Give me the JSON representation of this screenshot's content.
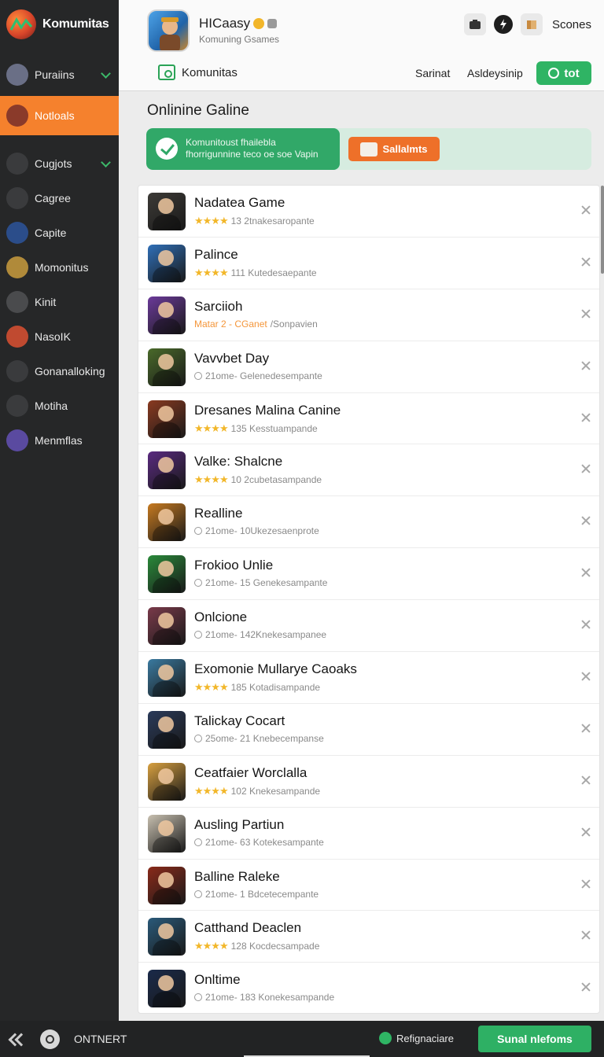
{
  "sidebar": {
    "brand": "Komumitas",
    "items": [
      {
        "label": "Puraiins",
        "icon": "controller-icon",
        "color": "#6a6f86",
        "chevron": true
      },
      {
        "label": "Notloals",
        "icon": "avatar-icon",
        "color": "#8a3a2a",
        "active": true
      },
      {
        "label": "Cugjots",
        "icon": "hammer-icon",
        "color": "#3a3b3d",
        "chevron": true
      },
      {
        "label": "Cagree",
        "icon": "chart-icon",
        "color": "#3a3b3d"
      },
      {
        "label": "Capite",
        "icon": "globe-icon",
        "color": "#2b4d8a"
      },
      {
        "label": "Momonitus",
        "icon": "sun-icon",
        "color": "#b08a3a"
      },
      {
        "label": "Kinit",
        "icon": "camera-icon",
        "color": "#4a4b4d"
      },
      {
        "label": "NasoIK",
        "icon": "face-icon",
        "color": "#c04a30"
      },
      {
        "label": "Gonanalloking",
        "icon": "planet-icon",
        "color": "#3a3b3d"
      },
      {
        "label": "Motiha",
        "icon": "pin-icon",
        "color": "#3a3b3d"
      },
      {
        "label": "Menmflas",
        "icon": "wand-icon",
        "color": "#5a4aa0"
      }
    ]
  },
  "header": {
    "app_title": "HICaasy",
    "app_subtitle": "Komuning Gsames",
    "scones": "Scones",
    "tab": "Komunitas",
    "link_1": "Sarinat",
    "link_2": "Asldeysinip",
    "cta": "tot"
  },
  "main": {
    "section_title": "Onlinine Galine",
    "banner_line1": "Komunitoust fhailebla",
    "banner_line2": "fhorrigunnine teco oe soe Vapin",
    "banner_button": "Sallalmts"
  },
  "games": [
    {
      "name": "Nadatea Game",
      "meta": "13 2tnakesaropante",
      "stars": true,
      "color": "#3c3a36"
    },
    {
      "name": "Palince",
      "meta": "111 Kutedesaepante",
      "stars": true,
      "color": "#2f6fb8"
    },
    {
      "name": "Sarciioh",
      "meta_orange": "Matar 2 - CGanet",
      "meta": "/Sonpavien",
      "color": "#6b3a9a"
    },
    {
      "name": "Vavvbet Day",
      "meta": "21ome- Gelenedesempante",
      "pin": true,
      "color": "#4a6a2a"
    },
    {
      "name": "Dresanes Malina Canine",
      "meta": "135 Kesstuampande",
      "stars": true,
      "color": "#8a3a20"
    },
    {
      "name": "Valke: Shalcne",
      "meta": "10 2cubetasampande",
      "stars": true,
      "color": "#5a2a80"
    },
    {
      "name": "Realline",
      "meta": "21ome- 10Ukezesaenprote",
      "pin": true,
      "color": "#c77a20"
    },
    {
      "name": "Frokioo Unlie",
      "meta": "21ome- 15 Genekesampante",
      "pin": true,
      "color": "#2a8a3a"
    },
    {
      "name": "Onlcione",
      "meta": "21ome- 142Knekesampanee",
      "pin": true,
      "color": "#7a3a4a"
    },
    {
      "name": "Exomonie Mullarye Caoaks",
      "meta": "185 Kotadisampande",
      "stars": true,
      "color": "#3a7aa0"
    },
    {
      "name": "Talickay Cocart",
      "meta": "25ome- 21 Knebecempanse",
      "pin": true,
      "color": "#2a3a5a"
    },
    {
      "name": "Ceatfaier Worclalla",
      "meta": "102 Knekesampande",
      "stars": true,
      "color": "#d8a040"
    },
    {
      "name": "Ausling Partiun",
      "meta": "21ome- 63 Kotekesampante",
      "pin": true,
      "color": "#c8c0b0"
    },
    {
      "name": "Balline Raleke",
      "meta": "21ome- 1 Bdcetecempante",
      "pin": true,
      "color": "#8a2a1a"
    },
    {
      "name": "Catthand Deaclen",
      "meta": "128 Kocdecsampade",
      "stars": true,
      "color": "#2a5a7a"
    },
    {
      "name": "Onltime",
      "meta": "21ome- 183 Konekesampande",
      "pin": true,
      "color": "#1a2a4a"
    }
  ],
  "bottom": {
    "label": "ONTNERT",
    "refresh": "Refignaciare",
    "cta": "Sunal nlefoms"
  }
}
